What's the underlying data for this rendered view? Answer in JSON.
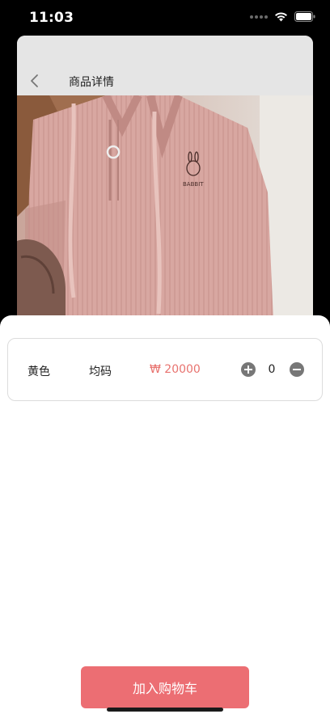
{
  "status_bar": {
    "time": "11:03"
  },
  "nav": {
    "title": "商品详情"
  },
  "product_image": {
    "logo_text": "BABBIT"
  },
  "sku": {
    "color": "黄色",
    "size": "均码",
    "price": "₩ 20000",
    "quantity": "0"
  },
  "actions": {
    "add_to_cart": "加入购物车"
  },
  "colors": {
    "accent": "#ec6e73",
    "price": "#e8736f",
    "sweater": "#d9a8a2"
  }
}
